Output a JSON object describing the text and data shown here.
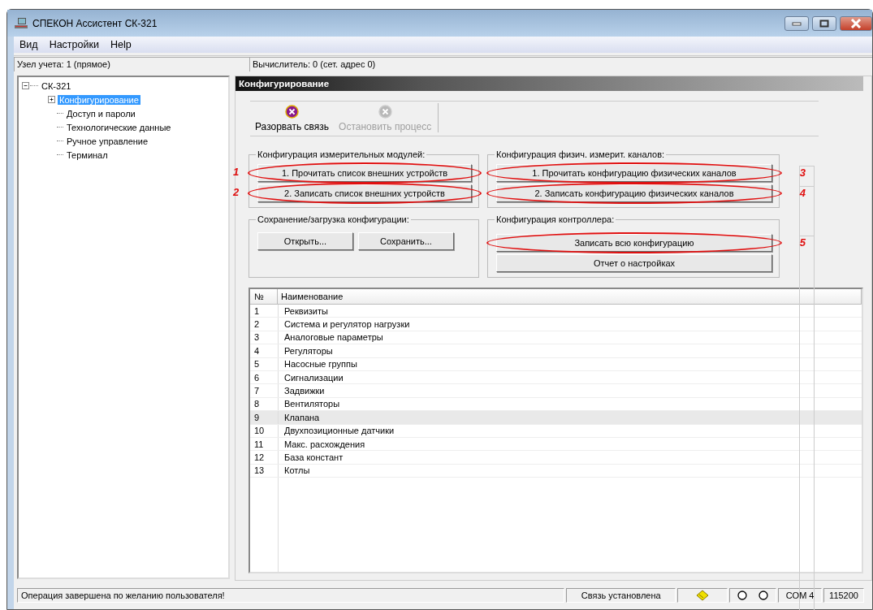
{
  "window": {
    "title": "СПЕКОН Ассистент СК-321"
  },
  "menu": [
    "Вид",
    "Настройки",
    "Help"
  ],
  "info_bar": [
    "Узел учета: 1 (прямое)",
    "Вычислитель: 0 (сет. адрес 0)"
  ],
  "tree": [
    {
      "label": "СК-321",
      "expanded": true,
      "selected": false,
      "children": [
        {
          "label": "Конфигурирование",
          "expanded": false,
          "selected": true
        },
        {
          "label": "Доступ и пароли",
          "selected": false
        },
        {
          "label": "Технологические данные",
          "selected": false
        },
        {
          "label": "Ручное управление",
          "selected": false
        },
        {
          "label": "Терминал",
          "selected": false
        }
      ]
    }
  ],
  "panel": {
    "title": "Конфигурирование",
    "toolbar": [
      {
        "label": "Разорвать связь",
        "disabled": false
      },
      {
        "label": "Остановить процесс",
        "disabled": true
      }
    ],
    "groups": [
      {
        "title": "Конфигурация измерительных модулей:",
        "buttons": [
          {
            "label": "1. Прочитать список внешних устройств",
            "annotation": "1"
          },
          {
            "label": "2. Записать список внешних устройств",
            "annotation": "2"
          }
        ]
      },
      {
        "title": "Конфигурация физич. измерит. каналов:",
        "buttons": [
          {
            "label": "1. Прочитать конфигурацию физических каналов",
            "annotation": "3"
          },
          {
            "label": "2. Записать конфигурацию физических каналов",
            "annotation": "4"
          }
        ]
      },
      {
        "title": "Сохранение/загрузка конфигурации:",
        "buttons": [
          {
            "label": "Открыть..."
          },
          {
            "label": "Сохранить..."
          }
        ]
      },
      {
        "title": "Конфигурация контроллера:",
        "buttons": [
          {
            "label": "Записать всю конфигурацию",
            "annotation": "5"
          },
          {
            "label": "Отчет о настройках"
          }
        ]
      }
    ],
    "table": {
      "columns": [
        "№",
        "Наименование"
      ],
      "rows": [
        {
          "no": "1",
          "name": "Реквизиты",
          "selected": false
        },
        {
          "no": "2",
          "name": "Система и регулятор нагрузки",
          "selected": false
        },
        {
          "no": "3",
          "name": "Аналоговые параметры",
          "selected": false
        },
        {
          "no": "4",
          "name": "Регуляторы",
          "selected": false
        },
        {
          "no": "5",
          "name": "Насосные группы",
          "selected": false
        },
        {
          "no": "6",
          "name": "Сигнализации",
          "selected": false
        },
        {
          "no": "7",
          "name": "Задвижки",
          "selected": false
        },
        {
          "no": "8",
          "name": "Вентиляторы",
          "selected": false
        },
        {
          "no": "9",
          "name": "Клапана",
          "selected": true
        },
        {
          "no": "10",
          "name": "Двухпозиционные датчики",
          "selected": false
        },
        {
          "no": "11",
          "name": "Макс. расхождения",
          "selected": false
        },
        {
          "no": "12",
          "name": "База констант",
          "selected": false
        },
        {
          "no": "13",
          "name": "Котлы",
          "selected": false
        }
      ]
    }
  },
  "status_bar": {
    "message": "Операция завершена по желанию пользователя!",
    "connection": "Связь установлена",
    "port": "COM 4",
    "baud": "115200"
  }
}
